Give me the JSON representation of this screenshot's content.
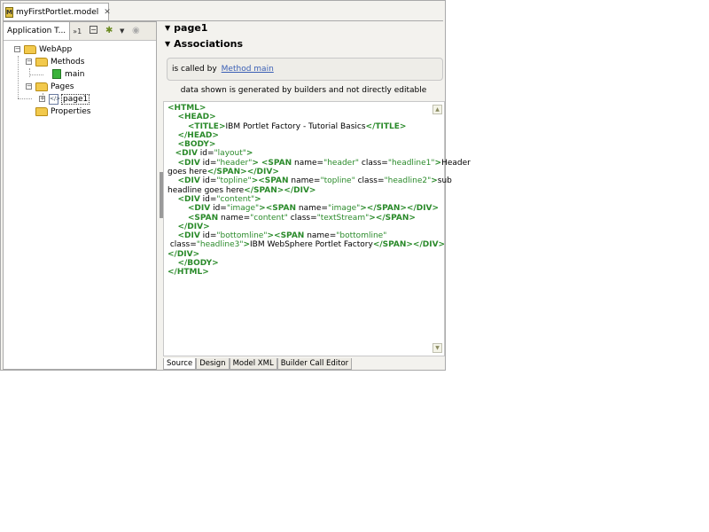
{
  "editor": {
    "tab_title": "myFirstPortlet.model",
    "close_glyph": "✕"
  },
  "left_panel": {
    "view_tab": "Application T...",
    "more_tabs": "»1",
    "tree": {
      "webapp": "WebApp",
      "methods": "Methods",
      "main": "main",
      "pages": "Pages",
      "page1": "page1",
      "properties": "Properties"
    },
    "icons": [
      "collapse-all-icon",
      "builder-gear-icon",
      "dropdown-arrow-icon",
      "eye-icon"
    ]
  },
  "right_panel": {
    "page_title": "page1",
    "associations_title": "Associations",
    "assoc_label": "is called by",
    "assoc_link": "Method main",
    "note": "data shown is generated by builders and not directly editable"
  },
  "bottom_tabs": [
    "Source",
    "Design",
    "Model XML",
    "Builder Call Editor"
  ],
  "colors": {
    "tag": "#2a8a2a",
    "link": "#3a5fb5",
    "folder": "#f2c94c"
  }
}
